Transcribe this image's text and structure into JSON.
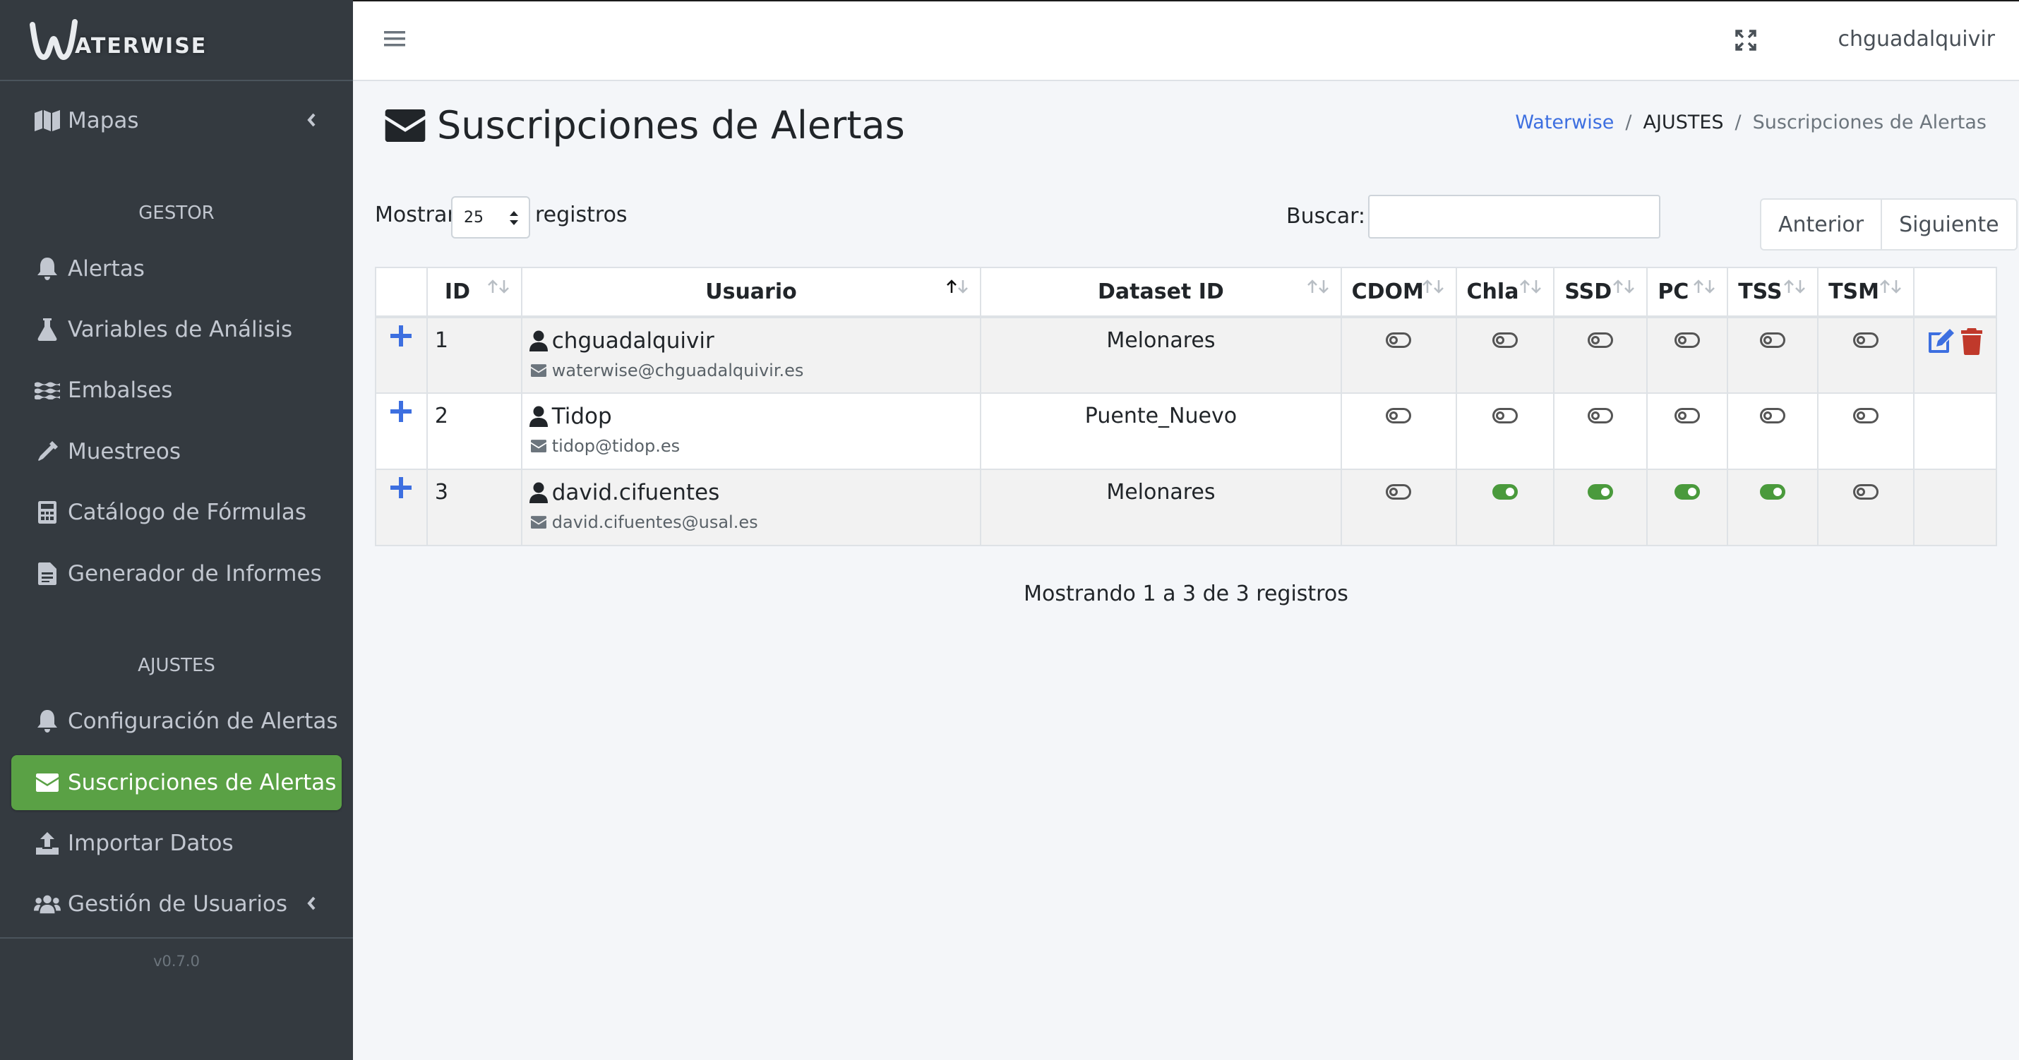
{
  "brand": {
    "logo_text": "ATERWISE"
  },
  "sidebar": {
    "items": [
      {
        "label": "Mapas",
        "icon": "map-icon",
        "has_chevron": true
      },
      {
        "label": "Alertas",
        "icon": "bell-icon"
      },
      {
        "label": "Variables de Análisis",
        "icon": "flask-icon"
      },
      {
        "label": "Embalses",
        "icon": "water-icon"
      },
      {
        "label": "Muestreos",
        "icon": "eyedropper-icon"
      },
      {
        "label": "Catálogo de Fórmulas",
        "icon": "calculator-icon"
      },
      {
        "label": "Generador de Informes",
        "icon": "file-report-icon"
      },
      {
        "label": "Configuración de Alertas",
        "icon": "bell-icon"
      },
      {
        "label": "Suscripciones de Alertas",
        "icon": "envelope-icon",
        "active": true
      },
      {
        "label": "Importar Datos",
        "icon": "upload-icon"
      },
      {
        "label": "Gestión de Usuarios",
        "icon": "users-icon",
        "has_chevron": true
      }
    ],
    "headers": {
      "gestor": "GESTOR",
      "ajustes": "AJUSTES"
    },
    "version": "v0.7.0"
  },
  "topbar": {
    "user": "chguadalquivir"
  },
  "page": {
    "title": "Suscripciones de Alertas",
    "breadcrumb": [
      "Waterwise",
      "AJUSTES",
      "Suscripciones de Alertas"
    ]
  },
  "table_controls": {
    "show_label": "Mostrar",
    "page_size": "25",
    "show_suffix": "registros",
    "search_label": "Buscar:",
    "search_value": "",
    "prev": "Anterior",
    "next": "Siguiente"
  },
  "table": {
    "columns": [
      "ID",
      "Usuario",
      "Dataset ID",
      "CDOM",
      "Chla",
      "SSD",
      "PC",
      "TSS",
      "TSM"
    ],
    "rows": [
      {
        "id": "1",
        "user": "chguadalquivir",
        "email": "waterwise@chguadalquivir.es",
        "dataset": "Melonares",
        "toggles": [
          false,
          false,
          false,
          false,
          false,
          false
        ],
        "has_actions": true
      },
      {
        "id": "2",
        "user": "Tidop",
        "email": "tidop@tidop.es",
        "dataset": "Puente_Nuevo",
        "toggles": [
          false,
          false,
          false,
          false,
          false,
          false
        ],
        "has_actions": false
      },
      {
        "id": "3",
        "user": "david.cifuentes",
        "email": "david.cifuentes@usal.es",
        "dataset": "Melonares",
        "toggles": [
          false,
          true,
          true,
          true,
          true,
          false
        ],
        "has_actions": false
      }
    ],
    "info": "Mostrando 1 a 3 de 3 registros"
  },
  "colors": {
    "sidebar_bg": "#343a40",
    "active_green": "#5aa145",
    "toggle_on": "#4a9a3c",
    "link_blue": "#3d6fe0",
    "delete_red": "#c0392b"
  }
}
